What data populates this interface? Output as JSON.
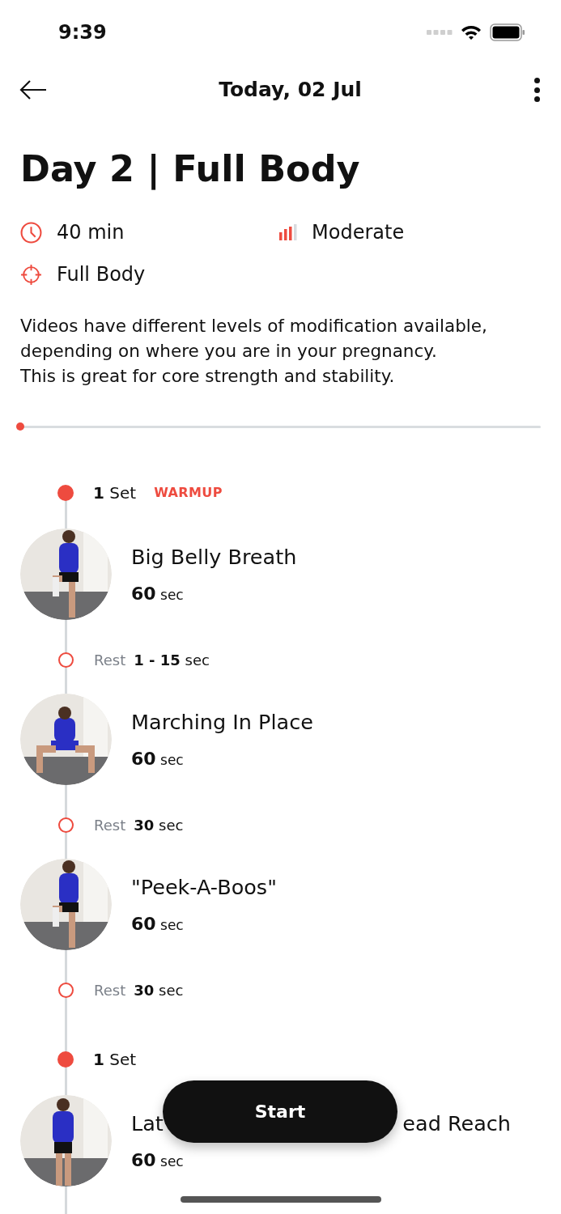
{
  "status_bar": {
    "time": "9:39"
  },
  "nav": {
    "title": "Today, 02 Jul"
  },
  "title": "Day 2 | Full Body",
  "meta": {
    "duration": "40 min",
    "difficulty": "Moderate",
    "focus": "Full Body"
  },
  "description": [
    "Videos have different levels of modification available,",
    "depending on where you are in your pregnancy.",
    "This is great for core strength and stability."
  ],
  "progress": {
    "level": 0
  },
  "timeline": [
    {
      "kind": "set",
      "count": "1",
      "unit": "Set",
      "tag": "WARMUP"
    },
    {
      "kind": "exercise",
      "name": "Big Belly Breath",
      "amount": "60",
      "unit": "sec",
      "picture": {
        "kind": "picture"
      }
    },
    {
      "kind": "rest",
      "label": "Rest",
      "amount": "1 - 15",
      "unit": "sec"
    },
    {
      "kind": "exercise",
      "name": "Marching In Place",
      "amount": "60",
      "unit": "sec",
      "picture": {
        "kind": "picture"
      }
    },
    {
      "kind": "rest",
      "label": "Rest",
      "amount": "30",
      "unit": "sec"
    },
    {
      "kind": "exercise",
      "name": "\"Peek-A-Boos\"",
      "amount": "60",
      "unit": "sec",
      "picture": {
        "kind": "picture"
      }
    },
    {
      "kind": "rest",
      "label": "Rest",
      "amount": "30",
      "unit": "sec"
    },
    {
      "kind": "set",
      "count": "1",
      "unit": "Set"
    },
    {
      "kind": "exercise",
      "name_parts": [
        "Lat",
        "ead Reach"
      ],
      "amount": "60",
      "unit": "sec",
      "picture": {
        "kind": "picture"
      }
    }
  ],
  "start_button": {
    "label": "Start"
  }
}
